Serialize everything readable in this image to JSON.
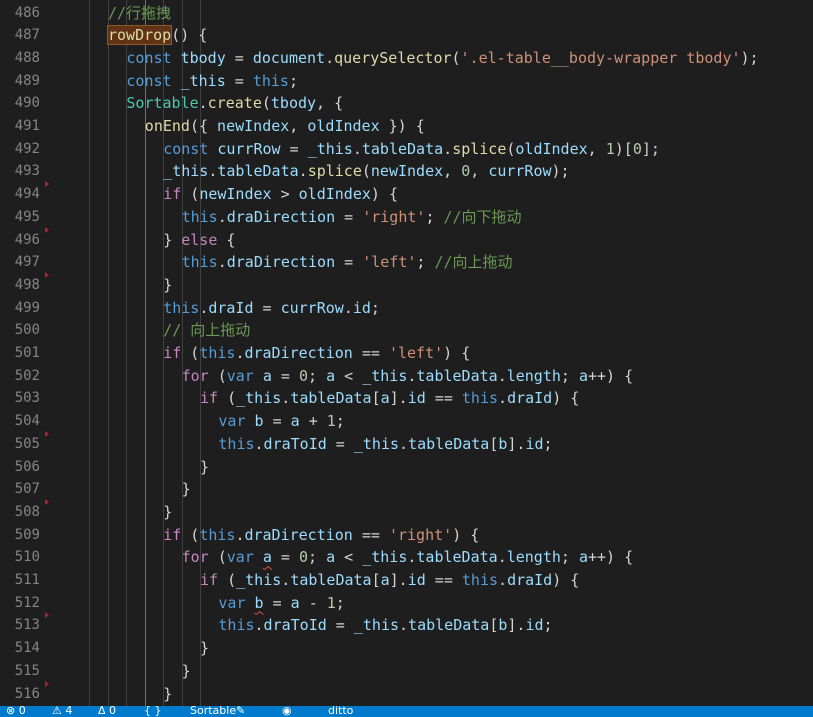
{
  "editor": {
    "lines": [
      {
        "n": "486",
        "indent": 0,
        "tokens": [
          {
            "t": "//行拖拽",
            "c": "t-cm"
          }
        ]
      },
      {
        "n": "487",
        "indent": 0,
        "tokens": [
          {
            "t": "rowDrop",
            "c": "t-f",
            "hl": true
          },
          {
            "t": "() {",
            "c": "t-p"
          }
        ]
      },
      {
        "n": "488",
        "indent": 1,
        "tokens": [
          {
            "t": "const ",
            "c": "t-k"
          },
          {
            "t": "tbody",
            "c": "t-v"
          },
          {
            "t": " = ",
            "c": "t-p"
          },
          {
            "t": "document",
            "c": "t-v"
          },
          {
            "t": ".",
            "c": "t-p"
          },
          {
            "t": "querySelector",
            "c": "t-f"
          },
          {
            "t": "(",
            "c": "t-p"
          },
          {
            "t": "'.el-table__body-wrapper tbody'",
            "c": "t-s"
          },
          {
            "t": ");",
            "c": "t-p"
          }
        ]
      },
      {
        "n": "489",
        "indent": 1,
        "tokens": [
          {
            "t": "const ",
            "c": "t-k"
          },
          {
            "t": "_this",
            "c": "t-v"
          },
          {
            "t": " = ",
            "c": "t-p"
          },
          {
            "t": "this",
            "c": "t-k"
          },
          {
            "t": ";",
            "c": "t-p"
          }
        ]
      },
      {
        "n": "490",
        "indent": 1,
        "tokens": [
          {
            "t": "Sortable",
            "c": "t-ty"
          },
          {
            "t": ".",
            "c": "t-p"
          },
          {
            "t": "create",
            "c": "t-f"
          },
          {
            "t": "(",
            "c": "t-p"
          },
          {
            "t": "tbody",
            "c": "t-v"
          },
          {
            "t": ", {",
            "c": "t-p"
          }
        ]
      },
      {
        "n": "491",
        "indent": 2,
        "tokens": [
          {
            "t": "onEnd",
            "c": "t-f"
          },
          {
            "t": "({ ",
            "c": "t-p"
          },
          {
            "t": "newIndex",
            "c": "t-v"
          },
          {
            "t": ", ",
            "c": "t-p"
          },
          {
            "t": "oldIndex",
            "c": "t-v"
          },
          {
            "t": " }) {",
            "c": "t-p"
          }
        ]
      },
      {
        "n": "492",
        "indent": 3,
        "tokens": [
          {
            "t": "const ",
            "c": "t-k"
          },
          {
            "t": "currRow",
            "c": "t-v"
          },
          {
            "t": " = ",
            "c": "t-p"
          },
          {
            "t": "_this",
            "c": "t-v"
          },
          {
            "t": ".",
            "c": "t-p"
          },
          {
            "t": "tableData",
            "c": "t-v"
          },
          {
            "t": ".",
            "c": "t-p"
          },
          {
            "t": "splice",
            "c": "t-f"
          },
          {
            "t": "(",
            "c": "t-p"
          },
          {
            "t": "oldIndex",
            "c": "t-v"
          },
          {
            "t": ", ",
            "c": "t-p"
          },
          {
            "t": "1",
            "c": "t-n"
          },
          {
            "t": ")[",
            "c": "t-p"
          },
          {
            "t": "0",
            "c": "t-n"
          },
          {
            "t": "];",
            "c": "t-p"
          }
        ]
      },
      {
        "n": "493",
        "indent": 3,
        "tokens": [
          {
            "t": "_this",
            "c": "t-v"
          },
          {
            "t": ".",
            "c": "t-p"
          },
          {
            "t": "tableData",
            "c": "t-v"
          },
          {
            "t": ".",
            "c": "t-p"
          },
          {
            "t": "splice",
            "c": "t-f"
          },
          {
            "t": "(",
            "c": "t-p"
          },
          {
            "t": "newIndex",
            "c": "t-v"
          },
          {
            "t": ", ",
            "c": "t-p"
          },
          {
            "t": "0",
            "c": "t-n"
          },
          {
            "t": ", ",
            "c": "t-p"
          },
          {
            "t": "currRow",
            "c": "t-v"
          },
          {
            "t": ");",
            "c": "t-p"
          }
        ]
      },
      {
        "n": "494",
        "indent": 3,
        "marker": true,
        "tokens": [
          {
            "t": "if",
            "c": "t-c"
          },
          {
            "t": " (",
            "c": "t-p"
          },
          {
            "t": "newIndex",
            "c": "t-v"
          },
          {
            "t": " > ",
            "c": "t-p"
          },
          {
            "t": "oldIndex",
            "c": "t-v"
          },
          {
            "t": ") {",
            "c": "t-p"
          }
        ]
      },
      {
        "n": "495",
        "indent": 4,
        "tokens": [
          {
            "t": "this",
            "c": "t-k"
          },
          {
            "t": ".",
            "c": "t-p"
          },
          {
            "t": "draDirection",
            "c": "t-v"
          },
          {
            "t": " = ",
            "c": "t-p"
          },
          {
            "t": "'right'",
            "c": "t-s"
          },
          {
            "t": "; ",
            "c": "t-p"
          },
          {
            "t": "//向下拖动",
            "c": "t-cm"
          }
        ]
      },
      {
        "n": "496",
        "indent": 3,
        "marker": true,
        "tokens": [
          {
            "t": "} ",
            "c": "t-p"
          },
          {
            "t": "else",
            "c": "t-c"
          },
          {
            "t": " {",
            "c": "t-p"
          }
        ]
      },
      {
        "n": "497",
        "indent": 4,
        "tokens": [
          {
            "t": "this",
            "c": "t-k"
          },
          {
            "t": ".",
            "c": "t-p"
          },
          {
            "t": "draDirection",
            "c": "t-v"
          },
          {
            "t": " = ",
            "c": "t-p"
          },
          {
            "t": "'left'",
            "c": "t-s"
          },
          {
            "t": "; ",
            "c": "t-p"
          },
          {
            "t": "//向上拖动",
            "c": "t-cm"
          }
        ]
      },
      {
        "n": "498",
        "indent": 3,
        "marker": true,
        "tokens": [
          {
            "t": "}",
            "c": "t-p"
          }
        ]
      },
      {
        "n": "499",
        "indent": 3,
        "tokens": [
          {
            "t": "this",
            "c": "t-k"
          },
          {
            "t": ".",
            "c": "t-p"
          },
          {
            "t": "draId",
            "c": "t-v"
          },
          {
            "t": " = ",
            "c": "t-p"
          },
          {
            "t": "currRow",
            "c": "t-v"
          },
          {
            "t": ".",
            "c": "t-p"
          },
          {
            "t": "id",
            "c": "t-v"
          },
          {
            "t": ";",
            "c": "t-p"
          }
        ]
      },
      {
        "n": "500",
        "indent": 3,
        "tokens": [
          {
            "t": "// 向上拖动",
            "c": "t-cm"
          }
        ]
      },
      {
        "n": "501",
        "indent": 3,
        "tokens": [
          {
            "t": "if",
            "c": "t-c"
          },
          {
            "t": " (",
            "c": "t-p"
          },
          {
            "t": "this",
            "c": "t-k"
          },
          {
            "t": ".",
            "c": "t-p"
          },
          {
            "t": "draDirection",
            "c": "t-v"
          },
          {
            "t": " == ",
            "c": "t-p"
          },
          {
            "t": "'left'",
            "c": "t-s"
          },
          {
            "t": ") {",
            "c": "t-p"
          }
        ]
      },
      {
        "n": "502",
        "indent": 4,
        "tokens": [
          {
            "t": "for",
            "c": "t-c"
          },
          {
            "t": " (",
            "c": "t-p"
          },
          {
            "t": "var",
            "c": "t-k"
          },
          {
            "t": " ",
            "c": "t-p"
          },
          {
            "t": "a",
            "c": "t-v"
          },
          {
            "t": " = ",
            "c": "t-p"
          },
          {
            "t": "0",
            "c": "t-n"
          },
          {
            "t": "; ",
            "c": "t-p"
          },
          {
            "t": "a",
            "c": "t-v"
          },
          {
            "t": " < ",
            "c": "t-p"
          },
          {
            "t": "_this",
            "c": "t-v"
          },
          {
            "t": ".",
            "c": "t-p"
          },
          {
            "t": "tableData",
            "c": "t-v"
          },
          {
            "t": ".",
            "c": "t-p"
          },
          {
            "t": "length",
            "c": "t-v"
          },
          {
            "t": "; ",
            "c": "t-p"
          },
          {
            "t": "a",
            "c": "t-v"
          },
          {
            "t": "++) {",
            "c": "t-p"
          }
        ]
      },
      {
        "n": "503",
        "indent": 5,
        "tokens": [
          {
            "t": "if",
            "c": "t-c"
          },
          {
            "t": " (",
            "c": "t-p"
          },
          {
            "t": "_this",
            "c": "t-v"
          },
          {
            "t": ".",
            "c": "t-p"
          },
          {
            "t": "tableData",
            "c": "t-v"
          },
          {
            "t": "[",
            "c": "t-p"
          },
          {
            "t": "a",
            "c": "t-v"
          },
          {
            "t": "].",
            "c": "t-p"
          },
          {
            "t": "id",
            "c": "t-v"
          },
          {
            "t": " == ",
            "c": "t-p"
          },
          {
            "t": "this",
            "c": "t-k"
          },
          {
            "t": ".",
            "c": "t-p"
          },
          {
            "t": "draId",
            "c": "t-v"
          },
          {
            "t": ") {",
            "c": "t-p"
          }
        ]
      },
      {
        "n": "504",
        "indent": 6,
        "tokens": [
          {
            "t": "var",
            "c": "t-k"
          },
          {
            "t": " ",
            "c": "t-p"
          },
          {
            "t": "b",
            "c": "t-v"
          },
          {
            "t": " = ",
            "c": "t-p"
          },
          {
            "t": "a",
            "c": "t-v"
          },
          {
            "t": " + ",
            "c": "t-p"
          },
          {
            "t": "1",
            "c": "t-n"
          },
          {
            "t": ";",
            "c": "t-p"
          }
        ]
      },
      {
        "n": "505",
        "indent": 6,
        "marker": true,
        "tokens": [
          {
            "t": "this",
            "c": "t-k"
          },
          {
            "t": ".",
            "c": "t-p"
          },
          {
            "t": "draToId",
            "c": "t-v"
          },
          {
            "t": " = ",
            "c": "t-p"
          },
          {
            "t": "_this",
            "c": "t-v"
          },
          {
            "t": ".",
            "c": "t-p"
          },
          {
            "t": "tableData",
            "c": "t-v"
          },
          {
            "t": "[",
            "c": "t-p"
          },
          {
            "t": "b",
            "c": "t-v"
          },
          {
            "t": "].",
            "c": "t-p"
          },
          {
            "t": "id",
            "c": "t-v"
          },
          {
            "t": ";",
            "c": "t-p"
          }
        ]
      },
      {
        "n": "506",
        "indent": 5,
        "tokens": [
          {
            "t": "}",
            "c": "t-p"
          }
        ]
      },
      {
        "n": "507",
        "indent": 4,
        "tokens": [
          {
            "t": "}",
            "c": "t-p"
          }
        ]
      },
      {
        "n": "508",
        "indent": 3,
        "marker": true,
        "tokens": [
          {
            "t": "}",
            "c": "t-p"
          }
        ]
      },
      {
        "n": "509",
        "indent": 3,
        "tokens": [
          {
            "t": "if",
            "c": "t-c"
          },
          {
            "t": " (",
            "c": "t-p"
          },
          {
            "t": "this",
            "c": "t-k"
          },
          {
            "t": ".",
            "c": "t-p"
          },
          {
            "t": "draDirection",
            "c": "t-v"
          },
          {
            "t": " == ",
            "c": "t-p"
          },
          {
            "t": "'right'",
            "c": "t-s"
          },
          {
            "t": ") {",
            "c": "t-p"
          }
        ]
      },
      {
        "n": "510",
        "indent": 4,
        "tokens": [
          {
            "t": "for",
            "c": "t-c"
          },
          {
            "t": " (",
            "c": "t-p"
          },
          {
            "t": "var",
            "c": "t-k"
          },
          {
            "t": " ",
            "c": "t-p"
          },
          {
            "t": "a",
            "c": "t-v",
            "sq": true
          },
          {
            "t": " = ",
            "c": "t-p"
          },
          {
            "t": "0",
            "c": "t-n"
          },
          {
            "t": "; ",
            "c": "t-p"
          },
          {
            "t": "a",
            "c": "t-v"
          },
          {
            "t": " < ",
            "c": "t-p"
          },
          {
            "t": "_this",
            "c": "t-v"
          },
          {
            "t": ".",
            "c": "t-p"
          },
          {
            "t": "tableData",
            "c": "t-v"
          },
          {
            "t": ".",
            "c": "t-p"
          },
          {
            "t": "length",
            "c": "t-v"
          },
          {
            "t": "; ",
            "c": "t-p"
          },
          {
            "t": "a",
            "c": "t-v"
          },
          {
            "t": "++) {",
            "c": "t-p"
          }
        ]
      },
      {
        "n": "511",
        "indent": 5,
        "tokens": [
          {
            "t": "if",
            "c": "t-c"
          },
          {
            "t": " (",
            "c": "t-p"
          },
          {
            "t": "_this",
            "c": "t-v"
          },
          {
            "t": ".",
            "c": "t-p"
          },
          {
            "t": "tableData",
            "c": "t-v"
          },
          {
            "t": "[",
            "c": "t-p"
          },
          {
            "t": "a",
            "c": "t-v"
          },
          {
            "t": "].",
            "c": "t-p"
          },
          {
            "t": "id",
            "c": "t-v"
          },
          {
            "t": " == ",
            "c": "t-p"
          },
          {
            "t": "this",
            "c": "t-k"
          },
          {
            "t": ".",
            "c": "t-p"
          },
          {
            "t": "draId",
            "c": "t-v"
          },
          {
            "t": ") {",
            "c": "t-p"
          }
        ]
      },
      {
        "n": "512",
        "indent": 6,
        "tokens": [
          {
            "t": "var",
            "c": "t-k"
          },
          {
            "t": " ",
            "c": "t-p"
          },
          {
            "t": "b",
            "c": "t-v",
            "sq": true
          },
          {
            "t": " = ",
            "c": "t-p"
          },
          {
            "t": "a",
            "c": "t-v"
          },
          {
            "t": " - ",
            "c": "t-p"
          },
          {
            "t": "1",
            "c": "t-n"
          },
          {
            "t": ";",
            "c": "t-p"
          }
        ]
      },
      {
        "n": "513",
        "indent": 6,
        "marker": true,
        "tokens": [
          {
            "t": "this",
            "c": "t-k"
          },
          {
            "t": ".",
            "c": "t-p"
          },
          {
            "t": "draToId",
            "c": "t-v"
          },
          {
            "t": " = ",
            "c": "t-p"
          },
          {
            "t": "_this",
            "c": "t-v"
          },
          {
            "t": ".",
            "c": "t-p"
          },
          {
            "t": "tableData",
            "c": "t-v"
          },
          {
            "t": "[",
            "c": "t-p"
          },
          {
            "t": "b",
            "c": "t-v"
          },
          {
            "t": "].",
            "c": "t-p"
          },
          {
            "t": "id",
            "c": "t-v"
          },
          {
            "t": ";",
            "c": "t-p"
          }
        ]
      },
      {
        "n": "514",
        "indent": 5,
        "tokens": [
          {
            "t": "}",
            "c": "t-p"
          }
        ]
      },
      {
        "n": "515",
        "indent": 4,
        "tokens": [
          {
            "t": "}",
            "c": "t-p"
          }
        ]
      },
      {
        "n": "516",
        "indent": 3,
        "marker": true,
        "tokens": [
          {
            "t": "}",
            "c": "t-p"
          }
        ]
      }
    ]
  },
  "statusbar": {
    "background": "#007acc",
    "items": [
      "⊗ 0",
      "⚠ 4",
      "Δ 0",
      "{ }",
      "Sortable",
      "✎",
      "◉",
      "ditto"
    ]
  }
}
